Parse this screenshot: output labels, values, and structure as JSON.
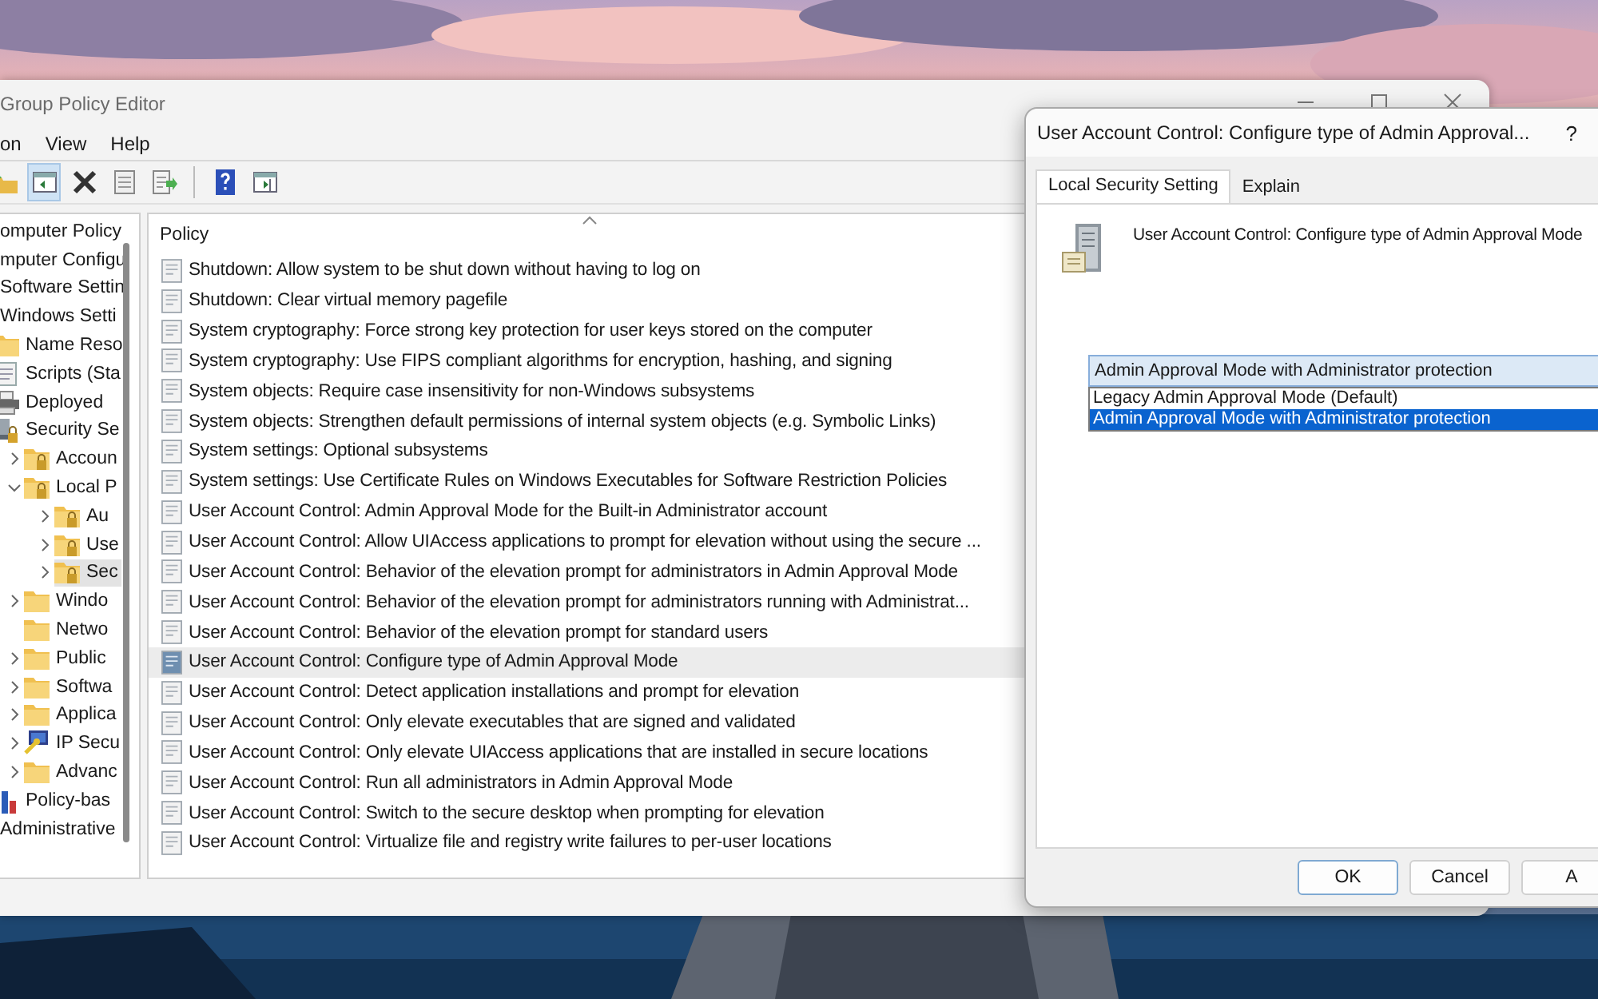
{
  "main_window": {
    "title": "Group Policy Editor",
    "menu": [
      "on",
      "View",
      "Help"
    ],
    "toolbar": [
      {
        "kind": "up",
        "pressed": false
      },
      {
        "kind": "tree-toggle",
        "pressed": true
      },
      {
        "kind": "delete",
        "pressed": false
      },
      {
        "kind": "properties",
        "pressed": false
      },
      {
        "kind": "export",
        "pressed": false
      },
      {
        "kind": "separator"
      },
      {
        "kind": "help",
        "pressed": false
      },
      {
        "kind": "pane-toggle",
        "pressed": false
      }
    ],
    "tree": [
      {
        "label": "omputer Policy",
        "kind": "label",
        "selected": false,
        "children": [
          {
            "label": "mputer Configu",
            "kind": "label",
            "selected": false,
            "children": [
              {
                "label": "Software Settin",
                "kind": "label",
                "selected": false
              },
              {
                "label": "Windows Setti",
                "kind": "label",
                "selected": false,
                "children": [
                  {
                    "label": "Name Reso",
                    "kind": "folder",
                    "selected": false
                  },
                  {
                    "label": "Scripts (Sta",
                    "kind": "scripts",
                    "selected": false
                  },
                  {
                    "label": "Deployed",
                    "kind": "printer",
                    "selected": false
                  },
                  {
                    "label": "Security Se",
                    "kind": "security",
                    "selected": false,
                    "children": [
                      {
                        "label": "Accoun",
                        "kind": "locked-folder",
                        "selected": false,
                        "expanded": false
                      },
                      {
                        "label": "Local P",
                        "kind": "locked-folder",
                        "selected": false,
                        "expanded": true,
                        "children": [
                          {
                            "label": "Au",
                            "kind": "locked-folder",
                            "selected": false,
                            "expanded": false
                          },
                          {
                            "label": "Use",
                            "kind": "locked-folder",
                            "selected": false,
                            "expanded": false
                          },
                          {
                            "label": "Sec",
                            "kind": "locked-folder",
                            "selected": true,
                            "expanded": false
                          }
                        ]
                      },
                      {
                        "label": "Windo",
                        "kind": "folder",
                        "selected": false,
                        "expanded": false
                      },
                      {
                        "label": "Netwo",
                        "kind": "folder",
                        "selected": false
                      },
                      {
                        "label": "Public",
                        "kind": "folder",
                        "selected": false,
                        "expanded": false
                      },
                      {
                        "label": "Softwa",
                        "kind": "folder",
                        "selected": false,
                        "expanded": false
                      },
                      {
                        "label": "Applica",
                        "kind": "folder",
                        "selected": false,
                        "expanded": false
                      },
                      {
                        "label": "IP Secu",
                        "kind": "ipsec",
                        "selected": false,
                        "expanded": false
                      },
                      {
                        "label": "Advanc",
                        "kind": "folder",
                        "selected": false,
                        "expanded": false
                      }
                    ]
                  },
                  {
                    "label": "Policy-bas",
                    "kind": "chart",
                    "selected": false
                  }
                ]
              },
              {
                "label": "Administrative",
                "kind": "label",
                "selected": false
              }
            ]
          }
        ]
      }
    ],
    "policy_list": {
      "column": "Policy",
      "rows": [
        {
          "label": "Shutdown: Allow system to be shut down without having to log on",
          "selected": false
        },
        {
          "label": "Shutdown: Clear virtual memory pagefile",
          "selected": false
        },
        {
          "label": "System cryptography: Force strong key protection for user keys stored on the computer",
          "selected": false
        },
        {
          "label": "System cryptography: Use FIPS compliant algorithms for encryption, hashing, and signing",
          "selected": false
        },
        {
          "label": "System objects: Require case insensitivity for non-Windows subsystems",
          "selected": false
        },
        {
          "label": "System objects: Strengthen default permissions of internal system objects (e.g. Symbolic Links)",
          "selected": false
        },
        {
          "label": "System settings: Optional subsystems",
          "selected": false
        },
        {
          "label": "System settings: Use Certificate Rules on Windows Executables for Software Restriction Policies",
          "selected": false
        },
        {
          "label": "User Account Control: Admin Approval Mode for the Built-in Administrator account",
          "selected": false
        },
        {
          "label": "User Account Control: Allow UIAccess applications to prompt for elevation without using the secure ...",
          "selected": false
        },
        {
          "label": "User Account Control: Behavior of the elevation prompt for administrators in Admin Approval Mode",
          "selected": false
        },
        {
          "label": "User Account Control: Behavior of the elevation prompt for administrators running with Administrat...",
          "selected": false
        },
        {
          "label": "User Account Control: Behavior of the elevation prompt for standard users",
          "selected": false
        },
        {
          "label": "User Account Control: Configure type of Admin Approval Mode",
          "selected": true
        },
        {
          "label": "User Account Control: Detect application installations and prompt for elevation",
          "selected": false
        },
        {
          "label": "User Account Control: Only elevate executables that are signed and validated",
          "selected": false
        },
        {
          "label": "User Account Control: Only elevate UIAccess applications that are installed in secure locations",
          "selected": false
        },
        {
          "label": "User Account Control: Run all administrators in Admin Approval Mode",
          "selected": false
        },
        {
          "label": "User Account Control: Switch to the secure desktop when prompting for elevation",
          "selected": false
        },
        {
          "label": "User Account Control: Virtualize file and registry write failures to per-user locations",
          "selected": false
        }
      ]
    }
  },
  "dialog": {
    "title": "User Account Control: Configure type of Admin Approval...",
    "help": "?",
    "tabs": [
      {
        "label": "Local Security Setting",
        "selected": true
      },
      {
        "label": "Explain",
        "selected": false
      }
    ],
    "heading": "User Account Control: Configure type of Admin Approval Mode",
    "dropdown": {
      "value": "Admin Approval Mode with Administrator protection",
      "expanded": true,
      "options": [
        {
          "label": "Legacy Admin Approval Mode (Default)",
          "selected": false
        },
        {
          "label": "Admin Approval Mode with Administrator protection",
          "selected": true
        }
      ]
    },
    "buttons": [
      {
        "label": "OK",
        "default": true
      },
      {
        "label": "Cancel",
        "default": false
      },
      {
        "label": "A",
        "default": false
      }
    ]
  }
}
